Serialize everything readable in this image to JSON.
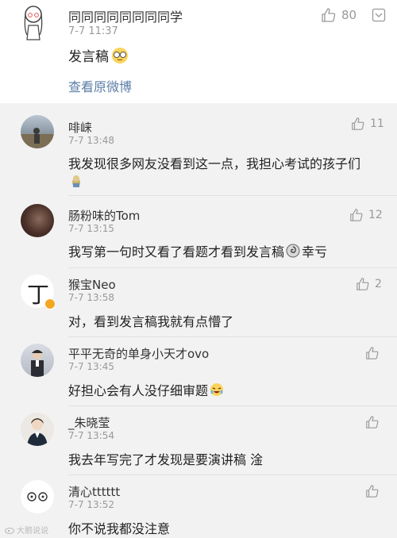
{
  "post": {
    "author": "同同同同同同同同学",
    "time": "7-7 11:37",
    "likes": "80",
    "text": "发言稿",
    "view_original": "查看原微博"
  },
  "comments": [
    {
      "name": "啡崃",
      "time": "7-7 13:48",
      "likes": "11",
      "text": "我发现很多网友没看到这一点，我担心考试的孩子们"
    },
    {
      "name": "肠粉味的Tom",
      "time": "7-7 13:15",
      "likes": "12",
      "text": "我写第一句时又看了看题才看到发言稿",
      "text_after": "幸亏"
    },
    {
      "name": "猴宝Neo",
      "time": "7-7 13:58",
      "likes": "2",
      "text": "对，看到发言稿我就有点懵了",
      "avatar_text": "丁"
    },
    {
      "name": "平平无奇的单身小天才ovo",
      "time": "7-7 13:45",
      "likes": "",
      "text": "好担心会有人没仔细审题"
    },
    {
      "name": "_朱晓莹",
      "time": "7-7 13:54",
      "likes": "",
      "text": "我去年写完了才发现是要演讲稿 淦"
    },
    {
      "name": "清心tttttt",
      "time": "7-7 13:52",
      "likes": "",
      "text": "你不说我都没注意"
    }
  ],
  "watermark": "大鹅说说",
  "colors": {
    "link": "#5b7ea6",
    "vip_badge": "#f5a623"
  }
}
